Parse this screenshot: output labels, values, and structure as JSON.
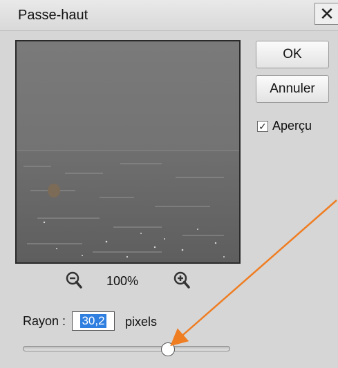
{
  "window": {
    "title": "Passe-haut",
    "close_glyph": "✕"
  },
  "buttons": {
    "ok": "OK",
    "cancel": "Annuler"
  },
  "preview_toggle": {
    "label": "Aperçu",
    "checked": true
  },
  "zoom": {
    "level": "100%",
    "zoom_out_icon": "zoom-out-icon",
    "zoom_in_icon": "zoom-in-icon"
  },
  "radius": {
    "label": "Rayon :",
    "value": "30,2",
    "unit": "pixels",
    "slider_fraction": 0.7
  },
  "colors": {
    "annotation_arrow": "#ef7d22",
    "selection": "#2f7fe0"
  }
}
